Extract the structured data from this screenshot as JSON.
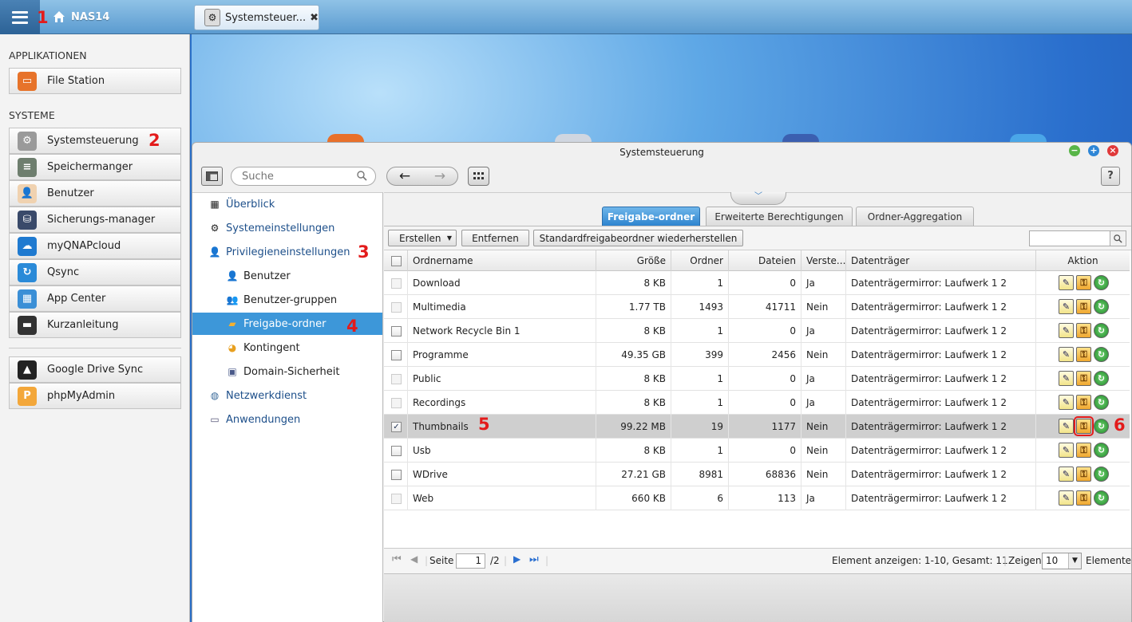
{
  "topbar": {
    "nas_name": "NAS14",
    "task_tab_label": "Systemsteuer...",
    "task_tab_close": "✖"
  },
  "sidebar": {
    "apps_heading": "APPLIKATIONEN",
    "systems_heading": "SYSTEME",
    "apps": [
      {
        "label": "File Station",
        "icon": "folder-icon"
      }
    ],
    "systems": [
      {
        "label": "Systemsteuerung",
        "icon": "gear-icon"
      },
      {
        "label": "Speichermanger",
        "icon": "storage-icon"
      },
      {
        "label": "Benutzer",
        "icon": "user-icon"
      },
      {
        "label": "Sicherungs-manager",
        "icon": "backup-icon"
      },
      {
        "label": "myQNAPcloud",
        "icon": "cloud-icon"
      },
      {
        "label": "Qsync",
        "icon": "sync-icon"
      },
      {
        "label": "App Center",
        "icon": "grid-icon"
      },
      {
        "label": "Kurzanleitung",
        "icon": "guide-icon"
      }
    ],
    "extra": [
      {
        "label": "Google Drive Sync",
        "icon": "google-drive-icon"
      },
      {
        "label": "phpMyAdmin",
        "icon": "phpmyadmin-icon"
      }
    ]
  },
  "window": {
    "title": "Systemsteuerung",
    "search_placeholder": "Suche",
    "help": "?",
    "nav": [
      {
        "label": "Überblick",
        "sub": false
      },
      {
        "label": "Systemeinstellungen",
        "sub": false
      },
      {
        "label": "Privilegieneinstellungen",
        "sub": false
      },
      {
        "label": "Benutzer",
        "sub": true
      },
      {
        "label": "Benutzer-gruppen",
        "sub": true
      },
      {
        "label": "Freigabe-ordner",
        "sub": true,
        "selected": true
      },
      {
        "label": "Kontingent",
        "sub": true
      },
      {
        "label": "Domain-Sicherheit",
        "sub": true
      },
      {
        "label": "Netzwerkdienst",
        "sub": false
      },
      {
        "label": "Anwendungen",
        "sub": false
      }
    ]
  },
  "content": {
    "tabs": [
      "Freigabe-ordner",
      "Erweiterte Berechtigungen",
      "Ordner-Aggregation"
    ],
    "actions": {
      "create": "Erstellen",
      "remove": "Entfernen",
      "restore": "Standardfreigabeordner wiederherstellen"
    },
    "columns": {
      "name": "Ordnername",
      "size": "Größe",
      "folders": "Ordner",
      "files": "Dateien",
      "hidden": "Verste...",
      "volume": "Datenträger",
      "action": "Aktion"
    },
    "rows": [
      {
        "name": "Download",
        "size": "8 KB",
        "folders": "1",
        "files": "0",
        "hidden": "Ja",
        "volume": "Datenträgermirror: Laufwerk 1 2",
        "checked": false,
        "disabled": true
      },
      {
        "name": "Multimedia",
        "size": "1.77 TB",
        "folders": "1493",
        "files": "41711",
        "hidden": "Nein",
        "volume": "Datenträgermirror: Laufwerk 1 2",
        "checked": false,
        "disabled": true
      },
      {
        "name": "Network Recycle Bin 1",
        "size": "8 KB",
        "folders": "1",
        "files": "0",
        "hidden": "Ja",
        "volume": "Datenträgermirror: Laufwerk 1 2",
        "checked": false,
        "disabled": false
      },
      {
        "name": "Programme",
        "size": "49.35 GB",
        "folders": "399",
        "files": "2456",
        "hidden": "Nein",
        "volume": "Datenträgermirror: Laufwerk 1 2",
        "checked": false,
        "disabled": false
      },
      {
        "name": "Public",
        "size": "8 KB",
        "folders": "1",
        "files": "0",
        "hidden": "Ja",
        "volume": "Datenträgermirror: Laufwerk 1 2",
        "checked": false,
        "disabled": true
      },
      {
        "name": "Recordings",
        "size": "8 KB",
        "folders": "1",
        "files": "0",
        "hidden": "Ja",
        "volume": "Datenträgermirror: Laufwerk 1 2",
        "checked": false,
        "disabled": true
      },
      {
        "name": "Thumbnails",
        "size": "99.22 MB",
        "folders": "19",
        "files": "1177",
        "hidden": "Nein",
        "volume": "Datenträgermirror: Laufwerk 1 2",
        "checked": true,
        "disabled": false,
        "selected": true
      },
      {
        "name": "Usb",
        "size": "8 KB",
        "folders": "1",
        "files": "0",
        "hidden": "Nein",
        "volume": "Datenträgermirror: Laufwerk 1 2",
        "checked": false,
        "disabled": false
      },
      {
        "name": "WDrive",
        "size": "27.21 GB",
        "folders": "8981",
        "files": "68836",
        "hidden": "Nein",
        "volume": "Datenträgermirror: Laufwerk 1 2",
        "checked": false,
        "disabled": false
      },
      {
        "name": "Web",
        "size": "660 KB",
        "folders": "6",
        "files": "113",
        "hidden": "Ja",
        "volume": "Datenträgermirror: Laufwerk 1 2",
        "checked": false,
        "disabled": true
      }
    ],
    "pager": {
      "page_label": "Seite",
      "page": "1",
      "total_pages": "/2",
      "summary": "Element anzeigen: 1-10, Gesamt: 11",
      "show_label": "Zeigen",
      "page_size": "10",
      "items_label": "Elemente"
    }
  },
  "annotations": [
    "1",
    "2",
    "3",
    "4",
    "5",
    "6"
  ],
  "colors": {
    "accent": "#3d97d9",
    "annotation": "#e31b1b"
  }
}
